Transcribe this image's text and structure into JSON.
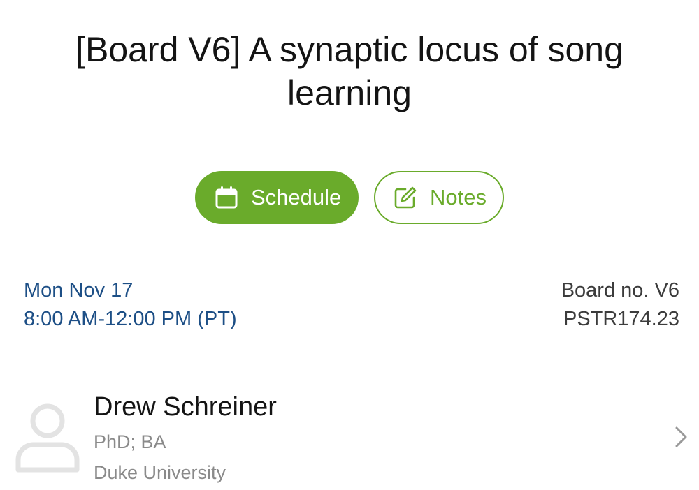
{
  "session": {
    "title": "[Board V6] A synaptic locus of song learning"
  },
  "actions": {
    "schedule_label": "Schedule",
    "schedule_icon": "calendar-icon",
    "notes_label": "Notes",
    "notes_icon": "edit-note-icon",
    "accent_color": "#6aab2b"
  },
  "details": {
    "date": "Mon Nov 17",
    "time": "8:00 AM-12:00 PM (PT)",
    "board": "Board no. V6",
    "code": "PSTR174.23",
    "date_color": "#1d4f86"
  },
  "author": {
    "avatar_icon": "user-avatar-icon",
    "name": "Drew Schreiner",
    "degree": "PhD; BA",
    "organization": "Duke University",
    "chevron_icon": "chevron-right-icon"
  }
}
